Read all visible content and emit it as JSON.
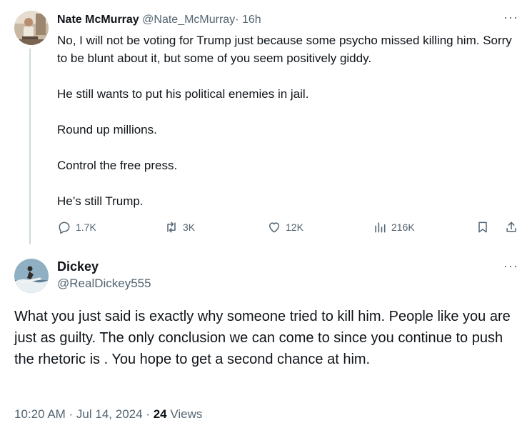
{
  "tweet1": {
    "author_name": "Nate McMurray",
    "author_handle": "@Nate_McMurray",
    "separator": "·",
    "time": "16h",
    "more_label": "···",
    "paragraphs": [
      "No, I will not be voting for Trump just because some psycho missed killing him. Sorry to be blunt about it, but some of you seem positively giddy.",
      "He still wants to put his political enemies in jail.",
      "Round up millions.",
      "Control the free press.",
      "He’s still Trump."
    ],
    "stats": {
      "replies": "1.7K",
      "reposts": "3K",
      "likes": "12K",
      "views": "216K"
    }
  },
  "tweet2": {
    "author_name": "Dickey",
    "author_handle": "@RealDickey555",
    "more_label": "···",
    "text": "What you just said is exactly why someone tried to kill him. People like you are just as guilty. The only conclusion we can come to since you continue to push the rhetoric is . You hope to get a second chance at him.",
    "timestamp": "10:20 AM · Jul 14, 2024",
    "separator": "·",
    "view_count": "24",
    "views_label": "Views"
  },
  "colors": {
    "text": "#0f1419",
    "secondary": "#536471",
    "thread_line": "#cfd9de"
  },
  "icons": [
    "reply-icon",
    "repost-icon",
    "like-icon",
    "views-icon",
    "bookmark-icon",
    "share-icon",
    "more-icon"
  ]
}
